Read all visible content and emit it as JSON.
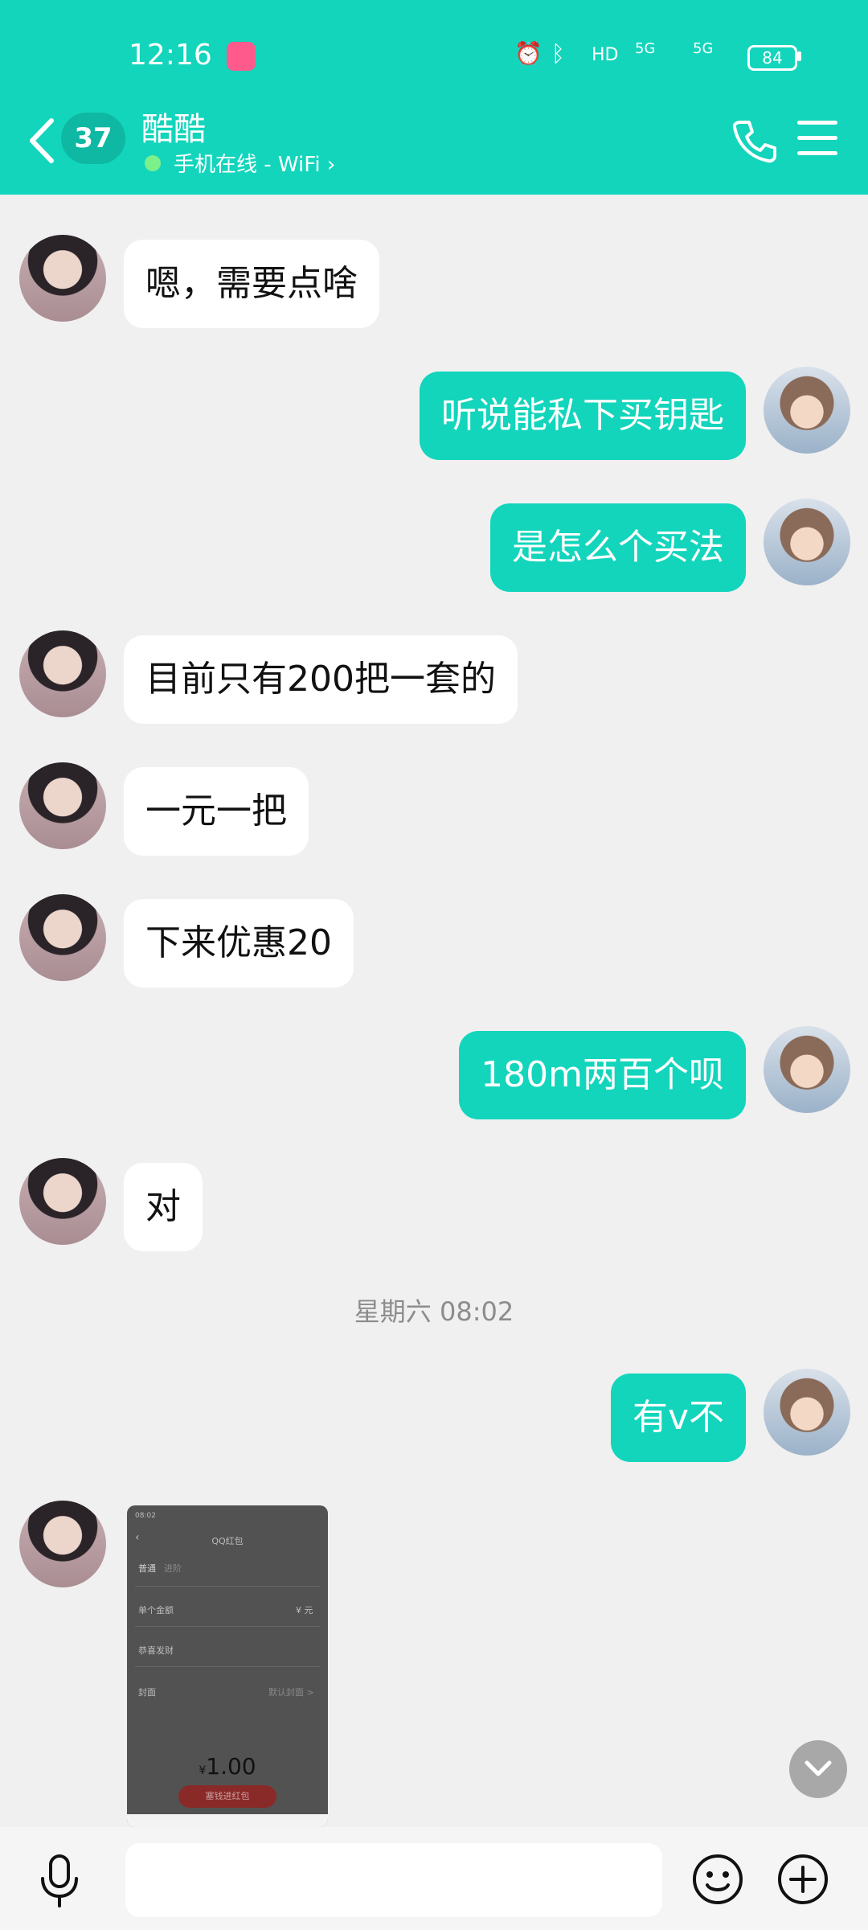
{
  "status_bar": {
    "time": "12:16",
    "battery": "84",
    "network_labels": [
      "HD",
      "5G",
      "5G"
    ]
  },
  "header": {
    "unread_count": "37",
    "contact_name": "酷酷",
    "status": "手机在线 - WiFi ›"
  },
  "messages": [
    {
      "side": "left",
      "text": "嗯，需要点啥"
    },
    {
      "side": "right",
      "text": "听说能私下买钥匙"
    },
    {
      "side": "right",
      "text": "是怎么个买法"
    },
    {
      "side": "left",
      "text": "目前只有200把一套的"
    },
    {
      "side": "left",
      "text": "一元一把"
    },
    {
      "side": "left",
      "text": "下来优惠20"
    },
    {
      "side": "right",
      "text": "180m两百个呗"
    },
    {
      "side": "left",
      "text": "对"
    },
    {
      "side": "right",
      "text": "有v不"
    }
  ],
  "timestamp": "星期六 08:02",
  "screenshot_message": {
    "time": "08:02",
    "title": "QQ红包",
    "tabs": [
      "普通",
      "进阶"
    ],
    "rows": [
      {
        "label": "单个金额",
        "value": "¥ 元"
      },
      {
        "label": "恭喜发财",
        "value": ""
      },
      {
        "label": "封面",
        "value": "默认封面 >"
      }
    ],
    "currency": "¥",
    "amount": "1.00",
    "button": "塞钱进红包"
  },
  "input": {
    "placeholder": ""
  },
  "colors": {
    "accent": "#12d5bc",
    "background": "#f0f0f0",
    "bubble_left": "#ffffff"
  },
  "icons": [
    "back-chevron-icon",
    "phone-icon",
    "menu-icon",
    "microphone-icon",
    "emoji-icon",
    "plus-icon",
    "chevron-down-icon"
  ]
}
